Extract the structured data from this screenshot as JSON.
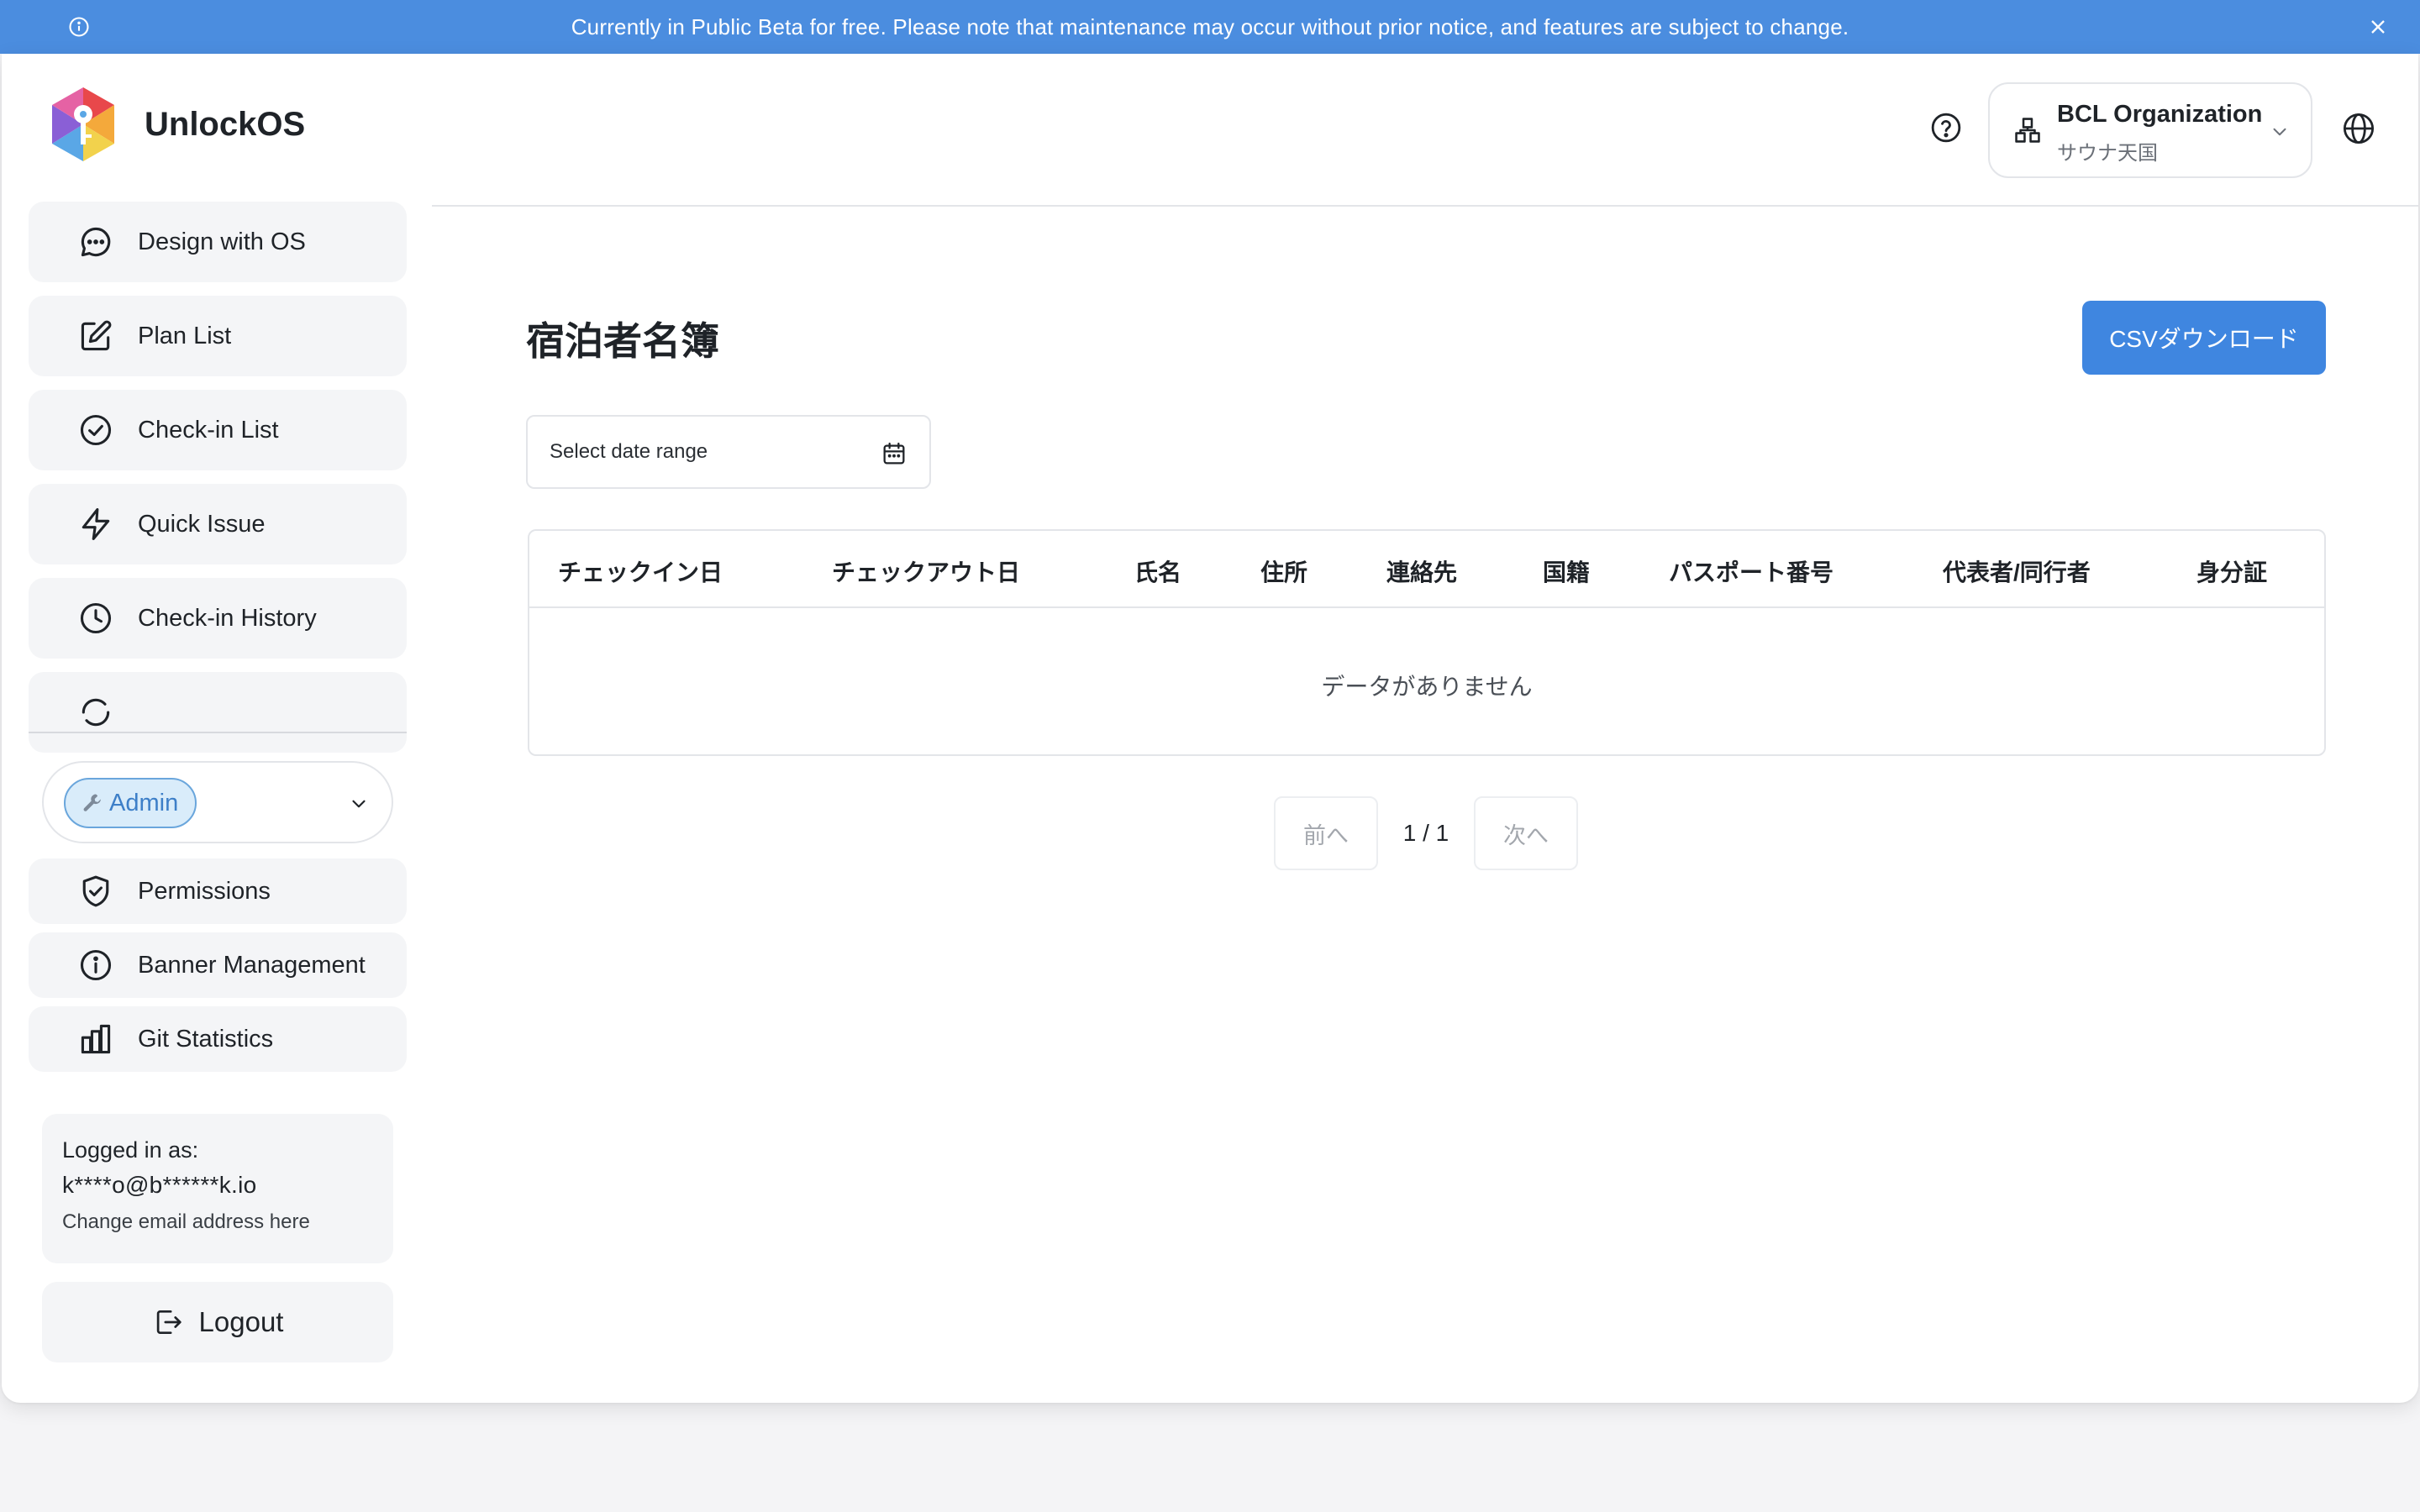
{
  "banner": {
    "text": "Currently in Public Beta for free. Please note that maintenance may occur without prior notice, and features are subject to change.",
    "info_icon": "info-icon",
    "close_icon": "close-icon",
    "bg_color": "#4b8ddf"
  },
  "brand": {
    "name": "UnlockOS",
    "logo_icon": "unlockos-logo"
  },
  "sidebar": {
    "nav": [
      {
        "label": "Design with OS",
        "icon": "chat-bubble-icon"
      },
      {
        "label": "Plan List",
        "icon": "edit-icon"
      },
      {
        "label": "Check-in List",
        "icon": "check-circle-icon"
      },
      {
        "label": "Quick Issue",
        "icon": "lightning-icon"
      },
      {
        "label": "Check-in History",
        "icon": "clock-icon"
      }
    ],
    "role": {
      "label": "Admin",
      "icon": "wrench-icon"
    },
    "admin_nav": [
      {
        "label": "Permissions",
        "icon": "shield-check-icon"
      },
      {
        "label": "Banner Management",
        "icon": "info-icon"
      },
      {
        "label": "Git Statistics",
        "icon": "bar-chart-icon"
      }
    ],
    "login": {
      "label": "Logged in as:",
      "email": "k****o@b******k.io",
      "change_link": "Change email address here"
    },
    "logout_label": "Logout"
  },
  "header": {
    "org_name": "BCL Organization",
    "org_sub": "サウナ天国",
    "help_icon": "help-circle-icon",
    "globe_icon": "globe-icon"
  },
  "main": {
    "title": "宿泊者名簿",
    "csv_button": "CSVダウンロード",
    "date_range_placeholder": "Select date range",
    "columns": [
      "チェックイン日",
      "チェックアウト日",
      "氏名",
      "住所",
      "連絡先",
      "国籍",
      "パスポート番号",
      "代表者/同行者",
      "身分証"
    ],
    "empty_text": "データがありません",
    "pager": {
      "prev": "前へ",
      "info": "1 / 1",
      "next": "次へ"
    },
    "accent_color": "#3f86e0"
  }
}
